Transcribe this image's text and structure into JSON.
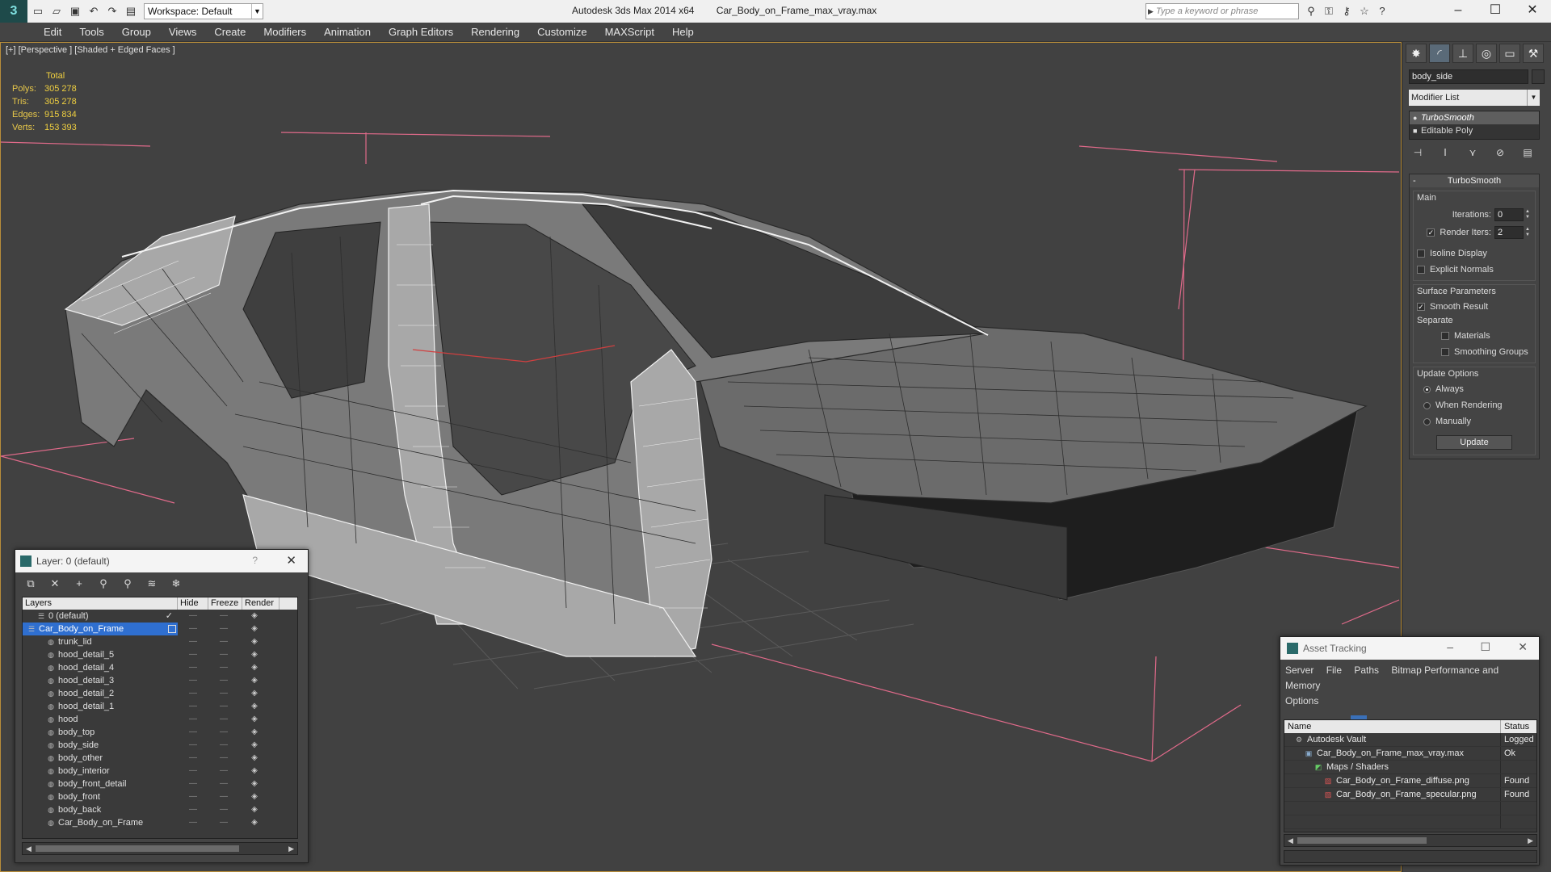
{
  "titlebar": {
    "workspace": "Workspace: Default",
    "app_title": "Autodesk 3ds Max 2014 x64",
    "file_title": "Car_Body_on_Frame_max_vray.max",
    "search_placeholder": "Type a keyword or phrase"
  },
  "menu": [
    "Edit",
    "Tools",
    "Group",
    "Views",
    "Create",
    "Modifiers",
    "Animation",
    "Graph Editors",
    "Rendering",
    "Customize",
    "MAXScript",
    "Help"
  ],
  "viewport": {
    "label": "[+] [Perspective ] [Shaded + Edged Faces ]",
    "stats": {
      "header": "Total",
      "rows": [
        {
          "k": "Polys:",
          "v": "305 278"
        },
        {
          "k": "Tris:",
          "v": "305 278"
        },
        {
          "k": "Edges:",
          "v": "915 834"
        },
        {
          "k": "Verts:",
          "v": "153 393"
        }
      ]
    },
    "accent_color": "#b88d3a",
    "bbox_color": "#e06a8a"
  },
  "command_panel": {
    "object_name": "body_side",
    "modifier_list": "Modifier List",
    "stack": [
      "TurboSmooth",
      "Editable Poly"
    ],
    "rollout_title": "TurboSmooth",
    "main_label": "Main",
    "iterations_label": "Iterations:",
    "iterations_value": "0",
    "render_iters_label": "Render Iters:",
    "render_iters_value": "2",
    "isoline": "Isoline Display",
    "explicit_normals": "Explicit Normals",
    "surface_params": "Surface Parameters",
    "smooth_result": "Smooth Result",
    "separate": "Separate",
    "materials": "Materials",
    "smoothing_groups": "Smoothing Groups",
    "update_options": "Update Options",
    "always": "Always",
    "when_rendering": "When Rendering",
    "manually": "Manually",
    "update_button": "Update"
  },
  "layer_window": {
    "title": "Layer: 0 (default)",
    "help": "?",
    "columns": [
      "Layers",
      "Hide",
      "Freeze",
      "Render"
    ],
    "rows": [
      {
        "name": "0 (default)",
        "level": 1,
        "kind": "layer"
      },
      {
        "name": "Car_Body_on_Frame",
        "level": 0,
        "kind": "layer",
        "selected": true
      },
      {
        "name": "trunk_lid",
        "level": 2,
        "kind": "object"
      },
      {
        "name": "hood_detail_5",
        "level": 2,
        "kind": "object"
      },
      {
        "name": "hood_detail_4",
        "level": 2,
        "kind": "object"
      },
      {
        "name": "hood_detail_3",
        "level": 2,
        "kind": "object"
      },
      {
        "name": "hood_detail_2",
        "level": 2,
        "kind": "object"
      },
      {
        "name": "hood_detail_1",
        "level": 2,
        "kind": "object"
      },
      {
        "name": "hood",
        "level": 2,
        "kind": "object"
      },
      {
        "name": "body_top",
        "level": 2,
        "kind": "object"
      },
      {
        "name": "body_side",
        "level": 2,
        "kind": "object"
      },
      {
        "name": "body_other",
        "level": 2,
        "kind": "object"
      },
      {
        "name": "body_interior",
        "level": 2,
        "kind": "object"
      },
      {
        "name": "body_front_detail",
        "level": 2,
        "kind": "object"
      },
      {
        "name": "body_front",
        "level": 2,
        "kind": "object"
      },
      {
        "name": "body_back",
        "level": 2,
        "kind": "object"
      },
      {
        "name": "Car_Body_on_Frame",
        "level": 2,
        "kind": "object"
      }
    ]
  },
  "asset_window": {
    "title": "Asset Tracking",
    "menu": [
      "Server",
      "File",
      "Paths",
      "Bitmap Performance and Memory",
      "Options"
    ],
    "columns": [
      "Name",
      "Status"
    ],
    "rows": [
      {
        "name": "Autodesk Vault",
        "status": "Logged",
        "indent": 1,
        "icon": "vault-icon"
      },
      {
        "name": "Car_Body_on_Frame_max_vray.max",
        "status": "Ok",
        "indent": 2,
        "icon": "max-file-icon"
      },
      {
        "name": "Maps / Shaders",
        "status": "",
        "indent": 3,
        "icon": "maps-icon"
      },
      {
        "name": "Car_Body_on_Frame_diffuse.png",
        "status": "Found",
        "indent": 4,
        "icon": "png-icon"
      },
      {
        "name": "Car_Body_on_Frame_specular.png",
        "status": "Found",
        "indent": 4,
        "icon": "png-icon"
      }
    ]
  }
}
